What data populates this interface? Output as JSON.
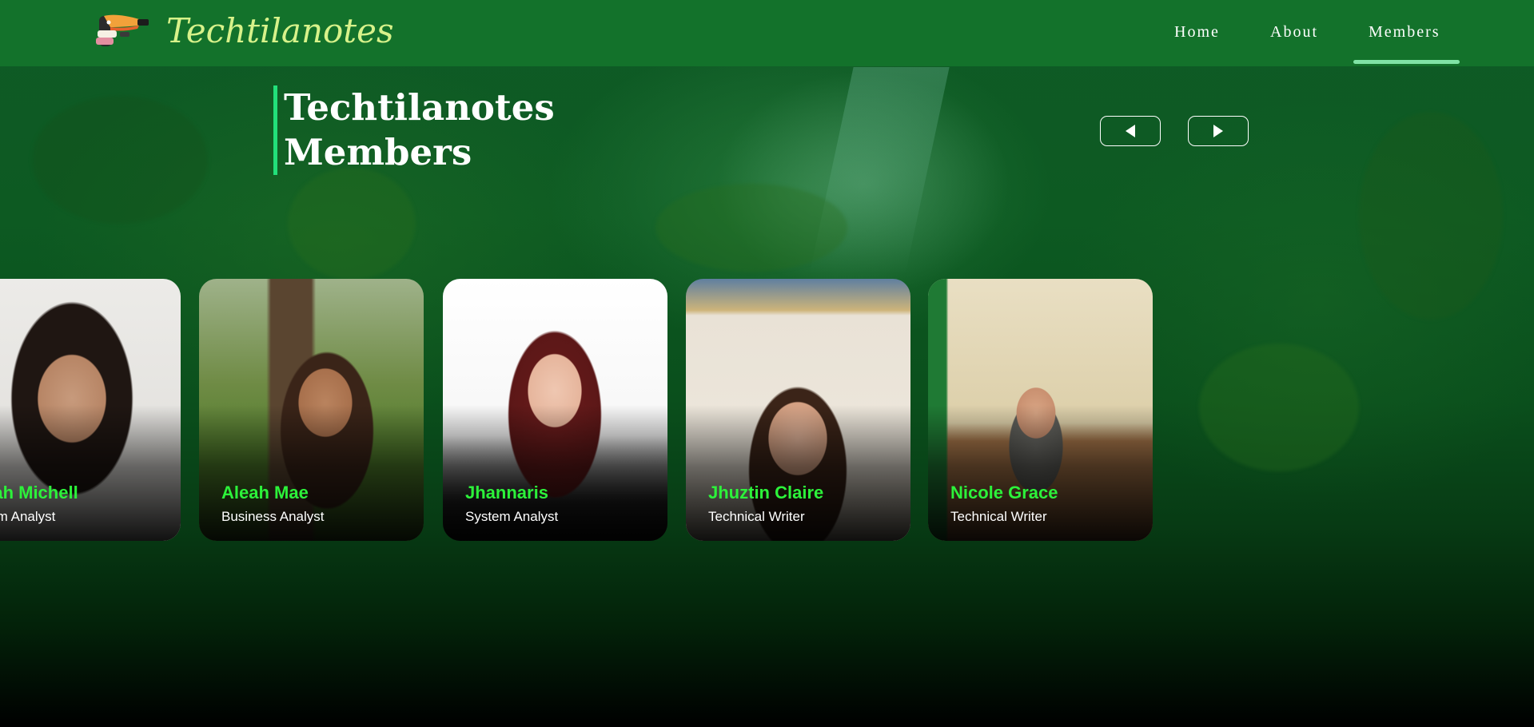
{
  "brand": {
    "name": "Techtilanotes",
    "logo_icon": "toucan-logo-icon"
  },
  "nav": {
    "items": [
      {
        "label": "Home"
      },
      {
        "label": "About"
      },
      {
        "label": "Members",
        "active": true
      }
    ],
    "accent_color": "#7fe3a5"
  },
  "section": {
    "title_line1": "Techtilanotes",
    "title_line2": "Members",
    "accent_color": "#22e07a"
  },
  "carousel": {
    "prev_icon": "caret-left-icon",
    "next_icon": "caret-right-icon",
    "members": [
      {
        "name": "lliah Michell",
        "role": "stem Analyst",
        "photo_bg": "#e8e6e2"
      },
      {
        "name": "Aleah Mae",
        "role": "Business Analyst",
        "photo_bg": "#7d8f55"
      },
      {
        "name": "Jhannaris",
        "role": "System Analyst",
        "photo_bg": "#f4f4f4"
      },
      {
        "name": "Jhuztin Claire",
        "role": "Technical Writer",
        "photo_bg": "#d9cfbf"
      },
      {
        "name": "Nicole Grace",
        "role": "Technical Writer",
        "photo_bg": "#d8c9a4"
      }
    ],
    "name_color": "#2cf23a"
  },
  "colors": {
    "header_bg": "#13722b",
    "brand_text": "#d7f28a"
  }
}
